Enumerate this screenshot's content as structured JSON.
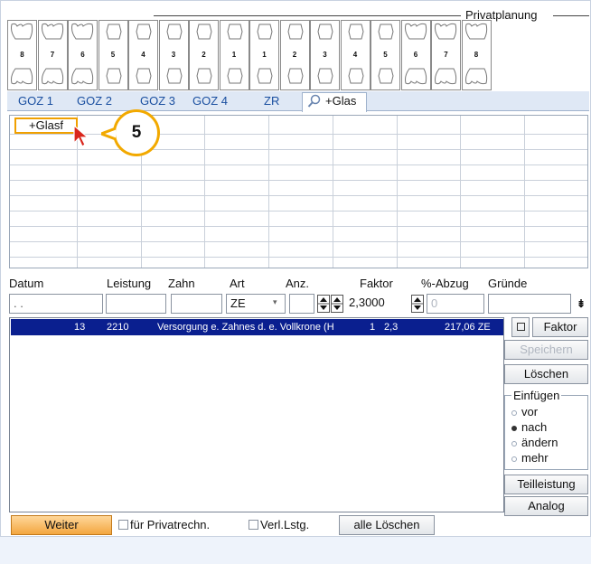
{
  "header": {
    "title": "Privatplanung"
  },
  "teeth_upper": [
    "8",
    "7",
    "6",
    "5",
    "4",
    "3",
    "2",
    "1",
    "1",
    "2",
    "3",
    "4",
    "5",
    "6",
    "7",
    "8"
  ],
  "tabs": [
    "GOZ 1",
    "GOZ 2",
    "GOZ 3",
    "GOZ 4",
    "ZR",
    "+Glas"
  ],
  "grid": {
    "chip": "+Glasf"
  },
  "callout": {
    "number": "5"
  },
  "form": {
    "labels": [
      "Datum",
      "Leistung",
      "Zahn",
      "Art",
      "Anz.",
      "Faktor",
      "%-Abzug",
      "Gründe"
    ],
    "datum_value": ". .",
    "art_value": "ZE",
    "faktor_value": "2,3000",
    "abzug_value": "0"
  },
  "list": {
    "selected_row": {
      "tooth": "13",
      "code": "2210",
      "description": "Versorgung e. Zahnes d. e. Vollkrone (H",
      "count": "1",
      "factor": "2,3",
      "amount": "217,06 ZE"
    }
  },
  "side": {
    "faktor_button": "Faktor",
    "speichern_button": "Speichern",
    "loeschen_button": "Löschen",
    "einfuegen_group": "Einfügen",
    "radio_vor": "vor",
    "radio_nach": "nach",
    "radio_aendern": "ändern",
    "radio_mehr": "mehr",
    "teilleistung_button": "Teilleistung",
    "analog_button": "Analog"
  },
  "bottom": {
    "weiter_button": "Weiter",
    "privatrechn_label": "für Privatrechn.",
    "verl_label": "Verl.Lstg.",
    "alle_loeschen_button": "alle Löschen"
  }
}
